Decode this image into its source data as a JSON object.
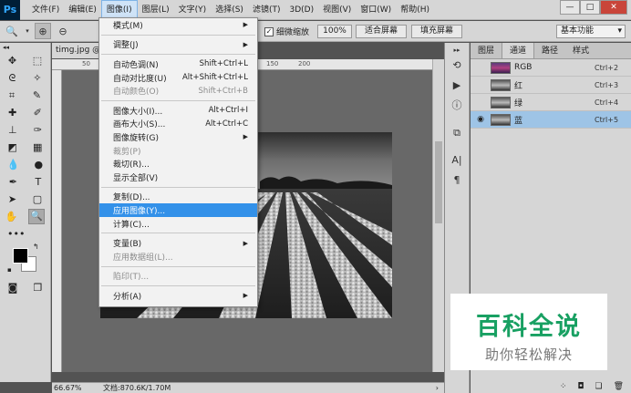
{
  "menubar": {
    "logo": "Ps",
    "items": [
      "文件(F)",
      "编辑(E)",
      "图像(I)",
      "图层(L)",
      "文字(Y)",
      "选择(S)",
      "滤镜(T)",
      "3D(D)",
      "视图(V)",
      "窗口(W)",
      "帮助(H)"
    ],
    "active_index": 2,
    "window_controls": [
      "—",
      "□",
      "✕"
    ]
  },
  "options": {
    "scrubby_zoom_label": "细微缩放",
    "btn_100": "100%",
    "btn_fit": "适合屏幕",
    "btn_fill": "填充屏幕",
    "workspace": "基本功能"
  },
  "document": {
    "tab": "timg.jpg @",
    "ruler_marks": [
      "50",
      "100",
      "150",
      "200"
    ],
    "zoom": "66.67%",
    "doc_info": "文档:870.6K/1.70M"
  },
  "image_menu": [
    {
      "label": "模式(M)",
      "submenu": true
    },
    {
      "sep": true
    },
    {
      "label": "调整(J)",
      "submenu": true
    },
    {
      "sep": true
    },
    {
      "label": "自动色调(N)",
      "shortcut": "Shift+Ctrl+L"
    },
    {
      "label": "自动对比度(U)",
      "shortcut": "Alt+Shift+Ctrl+L"
    },
    {
      "label": "自动颜色(O)",
      "shortcut": "Shift+Ctrl+B",
      "disabled": true
    },
    {
      "sep": true
    },
    {
      "label": "图像大小(I)...",
      "shortcut": "Alt+Ctrl+I"
    },
    {
      "label": "画布大小(S)...",
      "shortcut": "Alt+Ctrl+C"
    },
    {
      "label": "图像旋转(G)",
      "submenu": true
    },
    {
      "label": "裁剪(P)",
      "disabled": true
    },
    {
      "label": "裁切(R)..."
    },
    {
      "label": "显示全部(V)"
    },
    {
      "sep": true
    },
    {
      "label": "复制(D)..."
    },
    {
      "label": "应用图像(Y)...",
      "highlight": true
    },
    {
      "label": "计算(C)..."
    },
    {
      "sep": true
    },
    {
      "label": "变量(B)",
      "submenu": true
    },
    {
      "label": "应用数据组(L)...",
      "disabled": true
    },
    {
      "sep": true
    },
    {
      "label": "陷印(T)...",
      "disabled": true
    },
    {
      "sep": true
    },
    {
      "label": "分析(A)",
      "submenu": true
    }
  ],
  "panel": {
    "tabs": [
      "图层",
      "通道",
      "路径",
      "样式"
    ],
    "active_tab": 1,
    "channels": [
      {
        "name": "RGB",
        "shortcut": "Ctrl+2",
        "thumb": "color"
      },
      {
        "name": "红",
        "shortcut": "Ctrl+3",
        "thumb": "gray"
      },
      {
        "name": "绿",
        "shortcut": "Ctrl+4",
        "thumb": "gray"
      },
      {
        "name": "蓝",
        "shortcut": "Ctrl+5",
        "thumb": "gray",
        "active": true
      }
    ]
  },
  "watermark": {
    "title": "百科全说",
    "subtitle": "助你轻松解决"
  },
  "colors": {
    "menu_highlight": "#3391e9",
    "watermark_green": "#18a062",
    "active_channel": "#9ec4e6"
  }
}
